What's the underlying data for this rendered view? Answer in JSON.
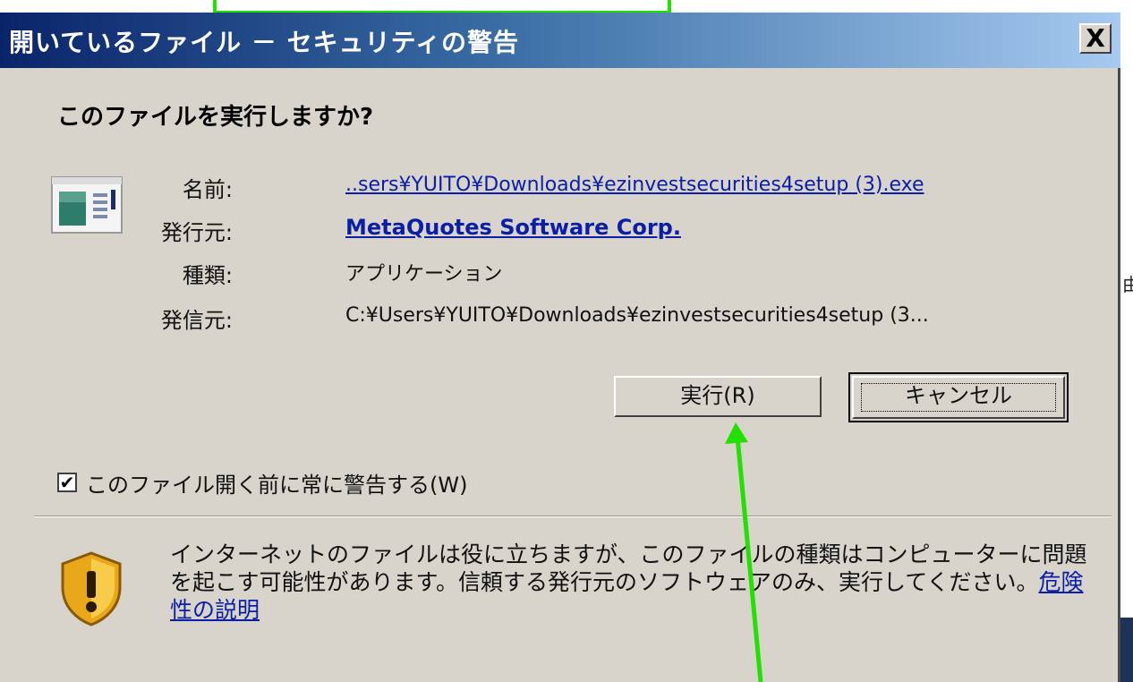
{
  "dialog": {
    "title": "開いているファイル － セキュリティの警告",
    "close_label": "X",
    "question": "このファイルを実行しますか?",
    "fields": [
      {
        "label": "名前:",
        "value": "..sers¥YUITO¥Downloads¥ezinvestsecurities4setup (3).exe"
      },
      {
        "label": "発行元:",
        "value": "MetaQuotes Software Corp."
      },
      {
        "label": "種類:",
        "value": "アプリケーション"
      },
      {
        "label": "発信元:",
        "value": "C:¥Users¥YUITO¥Downloads¥ezinvestsecurities4setup (3..."
      }
    ],
    "run_button": "実行(R)",
    "cancel_button": "キャンセル",
    "checkbox": {
      "label": "このファイル開く前に常に警告する(W)",
      "checked": true
    },
    "warning_text": "インターネットのファイルは役に立ちますが、このファイルの種類はコンピューターに問題を起こす可能性があります。信頼する発行元のソフトウェアのみ、実行してください。",
    "warning_link": "危険性の説明"
  },
  "background": {
    "right_fragment": "由"
  },
  "colors": {
    "annotation": "#22e000",
    "titlebar_start": "#0a246a",
    "titlebar_end": "#a6caf0",
    "link": "#0a1ea8",
    "dialog_bg": "#d8d4cc"
  }
}
